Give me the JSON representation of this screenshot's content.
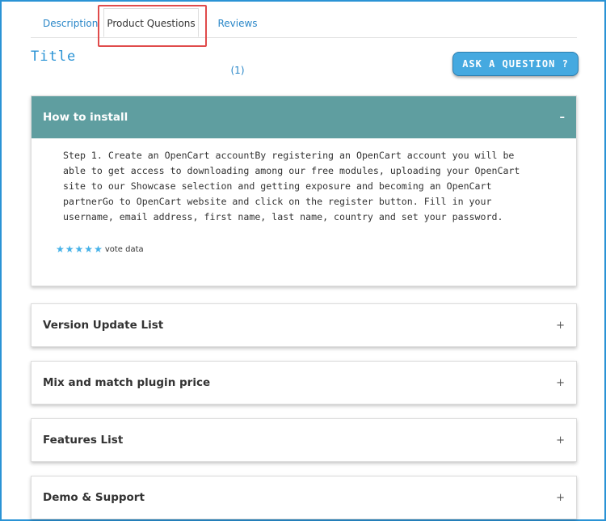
{
  "tabs": [
    {
      "label": "Description"
    },
    {
      "label": "Product Questions"
    },
    {
      "label": "Reviews (1)"
    }
  ],
  "title": "Title",
  "ask_button": {
    "label": "ASK A QUESTION ?"
  },
  "accordion": [
    {
      "title": "How to install",
      "toggle": "–",
      "body": "Step 1. Create an OpenCart accountBy registering an OpenCart account you will be\nable to get access to downloading among our free modules, uploading your OpenCart\nsite to our Showcase selection and getting exposure and becoming an OpenCart\npartnerGo to OpenCart website and click on the register button. Fill in your\nusername, email address, first name, last name, country and set your password.",
      "rating": {
        "stars": 5,
        "label": "vote data"
      }
    },
    {
      "title": "Version Update List",
      "toggle": "+"
    },
    {
      "title": "Mix and match plugin price",
      "toggle": "+"
    },
    {
      "title": "Features List",
      "toggle": "+"
    },
    {
      "title": "Demo & Support",
      "toggle": "+"
    }
  ],
  "colors": {
    "accent": "#2a93d5",
    "panel_header": "#5f9ea0",
    "highlight": "#e04b4b",
    "button": "#45a9e0",
    "star": "#45b1e8"
  }
}
